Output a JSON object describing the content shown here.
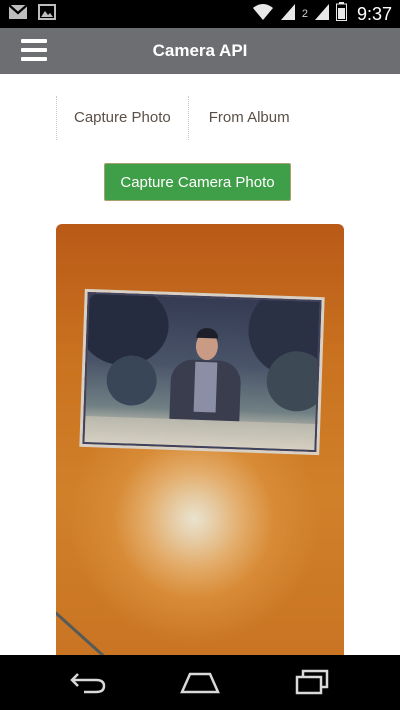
{
  "status_bar": {
    "time": "9:37",
    "sim_label": "2",
    "icons": [
      "gmail-icon",
      "gallery-icon",
      "wifi-icon",
      "signal-icon",
      "signal-2-icon",
      "battery-icon"
    ]
  },
  "header": {
    "title": "Camera API",
    "menu_icon": "hamburger-menu-icon",
    "background_color": "#6d6e71"
  },
  "tabs": [
    {
      "label": "Capture Photo"
    },
    {
      "label": "From Album"
    }
  ],
  "capture_button": {
    "label": "Capture Camera Photo",
    "color": "#3f9f48"
  },
  "photo_preview": {
    "content": "captured-photo-image"
  },
  "nav_bar": {
    "icons": [
      "back-icon",
      "home-icon",
      "recent-apps-icon"
    ]
  }
}
